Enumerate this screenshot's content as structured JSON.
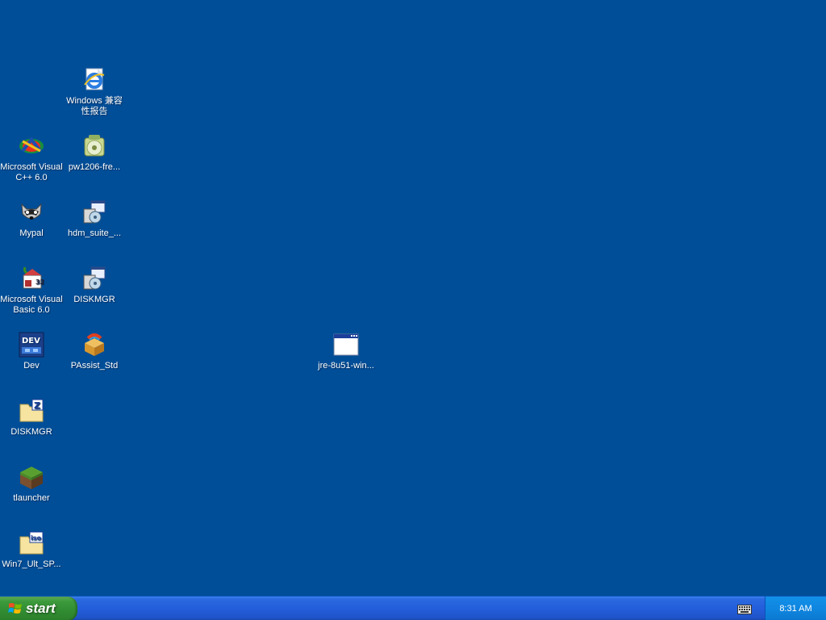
{
  "desktop": {
    "background_color": "#004e98",
    "icons": [
      {
        "id": "ie-compat",
        "label": "Windows 兼容\n性报告",
        "icon": "internet-explorer-icon"
      },
      {
        "id": "vcpp",
        "label": "Microsoft Visual\nC++ 6.0",
        "icon": "visual-cpp-icon"
      },
      {
        "id": "pw1206",
        "label": "pw1206-fre...",
        "icon": "installer-cd-icon"
      },
      {
        "id": "mypal",
        "label": "Mypal",
        "icon": "mypal-raccoon-icon"
      },
      {
        "id": "hdm",
        "label": "hdm_suite_...",
        "icon": "setup-installer-icon"
      },
      {
        "id": "vb6",
        "label": "Microsoft Visual\nBasic 6.0",
        "icon": "visual-basic-icon"
      },
      {
        "id": "diskmgr1",
        "label": "DISKMGR",
        "icon": "setup-installer-icon"
      },
      {
        "id": "dev",
        "label": "Dev",
        "icon": "dev-cpp-icon"
      },
      {
        "id": "passist",
        "label": "PAssist_Std",
        "icon": "package-box-icon"
      },
      {
        "id": "jre",
        "label": "jre-8u51-win...",
        "icon": "application-window-icon"
      },
      {
        "id": "diskmgr2",
        "label": "DISKMGR",
        "icon": "zip-folder-icon"
      },
      {
        "id": "tlauncher",
        "label": "tlauncher",
        "icon": "minecraft-grass-block-icon"
      },
      {
        "id": "win7",
        "label": "Win7_Ult_SP...",
        "icon": "iso-file-icon"
      }
    ]
  },
  "taskbar": {
    "start_label": "start",
    "clock": "8:31 AM",
    "tray_icons": [
      "keyboard-icon"
    ]
  }
}
